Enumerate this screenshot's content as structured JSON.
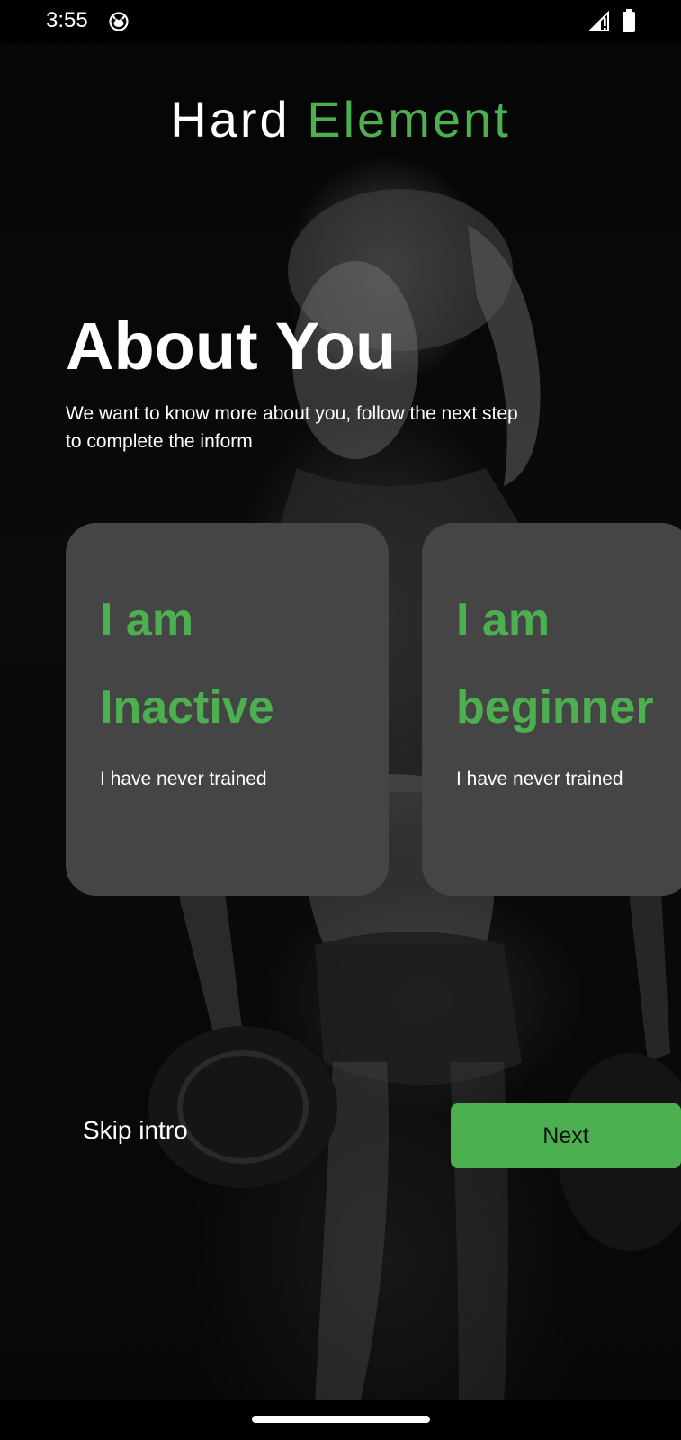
{
  "status_bar": {
    "time": "3:55",
    "app_icon": "cat-face-icon",
    "signal_icon": "signal-icon",
    "battery_icon": "battery-icon"
  },
  "app": {
    "title_part1": "Hard",
    "title_part2": "Element",
    "accent_color": "#4caf50"
  },
  "intro": {
    "heading": "About You",
    "text": "We want to know more about you, follow the next step\n to complete the inform"
  },
  "cards": [
    {
      "title": "I am\nInactive",
      "subtitle": "I have never trained"
    },
    {
      "title": "I am\nbeginner",
      "subtitle": "I have never trained"
    }
  ],
  "actions": {
    "skip_label": "Skip intro",
    "next_label": "Next"
  },
  "colors": {
    "card_bg": "#464546",
    "background": "#000000",
    "text": "#ffffff"
  }
}
